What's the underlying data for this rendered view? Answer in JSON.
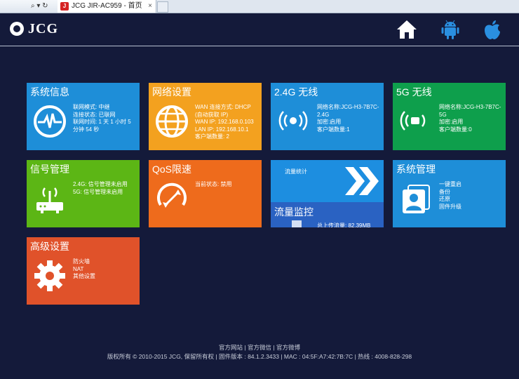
{
  "browser": {
    "tab_title": "JCG JIR-AC959 - 首页",
    "tab_close": "×",
    "controls": "⌕ ▾ ↻"
  },
  "header": {
    "logo_text": "JCG",
    "icons": [
      "home-icon",
      "android-icon",
      "apple-icon"
    ]
  },
  "tiles": {
    "system_info": {
      "title": "系统信息",
      "mode": "联网模式: 中继",
      "status": "连接状态: 已联网",
      "uptime": "联网时间: 1 天 1 小时 5 分钟 54 秒",
      "color": "#1e8ed8"
    },
    "network": {
      "title": "网络设置",
      "wan_type": "WAN 连接方式: DHCP (自动获取 IP)",
      "wan_ip": "WAN IP: 192.168.0.103",
      "lan_ip": "LAN IP: 192.168.10.1",
      "clients": "客户端数量: 2",
      "color": "#f3a11f"
    },
    "wifi24": {
      "title": "2.4G 无线",
      "ssid": "网络名称:JCG-H3-7B7C-2.4G",
      "security": "加密:启用",
      "clients": "客户端数量:1",
      "color": "#1e8ed8"
    },
    "wifi5": {
      "title": "5G 无线",
      "ssid": "网络名称:JCG-H3-7B7C-5G",
      "security": "加密:启用",
      "clients": "客户端数量:0",
      "color": "#0e9f4c"
    },
    "signal": {
      "title": "信号管理",
      "g24": "2.4G: 信号管理未启用",
      "g5": "5G: 信号管理未启用",
      "color": "#5cb615"
    },
    "qos": {
      "title": "QoS限速",
      "status": "当前状态: 禁用",
      "color": "#ee6b1c"
    },
    "traffic": {
      "stat_label": "流量统计",
      "title": "流量监控",
      "upload": "总上传流量: 82.39MB"
    },
    "sysmgmt": {
      "title": "系统管理",
      "reboot": "一键重启",
      "backup": "备份",
      "restore": "还原",
      "upgrade": "固件升级",
      "color": "#1e8ed8"
    },
    "advanced": {
      "title": "高级设置",
      "firewall": "防火墙",
      "nat": "NAT",
      "other": "其他设置",
      "color": "#e0522a"
    }
  },
  "footer": {
    "link_official": "官方网站",
    "link_wechat": "官方微信",
    "link_weibo": "官方微博",
    "sep": " | ",
    "copyright": "版权所有 © 2010-2015 JCG, 保留所有权",
    "firmware": "固件版本 : 84.1.2.3433",
    "mac": "MAC : 04:5F:A7:42:7B:7C",
    "hotline": "热线 : 4008-828-298"
  }
}
